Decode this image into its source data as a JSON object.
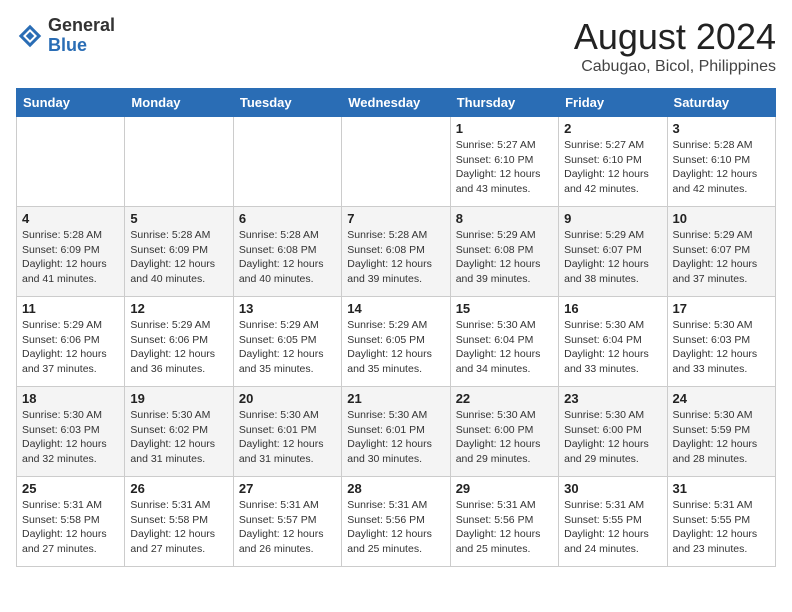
{
  "header": {
    "logo_general": "General",
    "logo_blue": "Blue",
    "title": "August 2024",
    "subtitle": "Cabugao, Bicol, Philippines"
  },
  "weekdays": [
    "Sunday",
    "Monday",
    "Tuesday",
    "Wednesday",
    "Thursday",
    "Friday",
    "Saturday"
  ],
  "weeks": [
    [
      {
        "day": "",
        "info": ""
      },
      {
        "day": "",
        "info": ""
      },
      {
        "day": "",
        "info": ""
      },
      {
        "day": "",
        "info": ""
      },
      {
        "day": "1",
        "info": "Sunrise: 5:27 AM\nSunset: 6:10 PM\nDaylight: 12 hours\nand 43 minutes."
      },
      {
        "day": "2",
        "info": "Sunrise: 5:27 AM\nSunset: 6:10 PM\nDaylight: 12 hours\nand 42 minutes."
      },
      {
        "day": "3",
        "info": "Sunrise: 5:28 AM\nSunset: 6:10 PM\nDaylight: 12 hours\nand 42 minutes."
      }
    ],
    [
      {
        "day": "4",
        "info": "Sunrise: 5:28 AM\nSunset: 6:09 PM\nDaylight: 12 hours\nand 41 minutes."
      },
      {
        "day": "5",
        "info": "Sunrise: 5:28 AM\nSunset: 6:09 PM\nDaylight: 12 hours\nand 40 minutes."
      },
      {
        "day": "6",
        "info": "Sunrise: 5:28 AM\nSunset: 6:08 PM\nDaylight: 12 hours\nand 40 minutes."
      },
      {
        "day": "7",
        "info": "Sunrise: 5:28 AM\nSunset: 6:08 PM\nDaylight: 12 hours\nand 39 minutes."
      },
      {
        "day": "8",
        "info": "Sunrise: 5:29 AM\nSunset: 6:08 PM\nDaylight: 12 hours\nand 39 minutes."
      },
      {
        "day": "9",
        "info": "Sunrise: 5:29 AM\nSunset: 6:07 PM\nDaylight: 12 hours\nand 38 minutes."
      },
      {
        "day": "10",
        "info": "Sunrise: 5:29 AM\nSunset: 6:07 PM\nDaylight: 12 hours\nand 37 minutes."
      }
    ],
    [
      {
        "day": "11",
        "info": "Sunrise: 5:29 AM\nSunset: 6:06 PM\nDaylight: 12 hours\nand 37 minutes."
      },
      {
        "day": "12",
        "info": "Sunrise: 5:29 AM\nSunset: 6:06 PM\nDaylight: 12 hours\nand 36 minutes."
      },
      {
        "day": "13",
        "info": "Sunrise: 5:29 AM\nSunset: 6:05 PM\nDaylight: 12 hours\nand 35 minutes."
      },
      {
        "day": "14",
        "info": "Sunrise: 5:29 AM\nSunset: 6:05 PM\nDaylight: 12 hours\nand 35 minutes."
      },
      {
        "day": "15",
        "info": "Sunrise: 5:30 AM\nSunset: 6:04 PM\nDaylight: 12 hours\nand 34 minutes."
      },
      {
        "day": "16",
        "info": "Sunrise: 5:30 AM\nSunset: 6:04 PM\nDaylight: 12 hours\nand 33 minutes."
      },
      {
        "day": "17",
        "info": "Sunrise: 5:30 AM\nSunset: 6:03 PM\nDaylight: 12 hours\nand 33 minutes."
      }
    ],
    [
      {
        "day": "18",
        "info": "Sunrise: 5:30 AM\nSunset: 6:03 PM\nDaylight: 12 hours\nand 32 minutes."
      },
      {
        "day": "19",
        "info": "Sunrise: 5:30 AM\nSunset: 6:02 PM\nDaylight: 12 hours\nand 31 minutes."
      },
      {
        "day": "20",
        "info": "Sunrise: 5:30 AM\nSunset: 6:01 PM\nDaylight: 12 hours\nand 31 minutes."
      },
      {
        "day": "21",
        "info": "Sunrise: 5:30 AM\nSunset: 6:01 PM\nDaylight: 12 hours\nand 30 minutes."
      },
      {
        "day": "22",
        "info": "Sunrise: 5:30 AM\nSunset: 6:00 PM\nDaylight: 12 hours\nand 29 minutes."
      },
      {
        "day": "23",
        "info": "Sunrise: 5:30 AM\nSunset: 6:00 PM\nDaylight: 12 hours\nand 29 minutes."
      },
      {
        "day": "24",
        "info": "Sunrise: 5:30 AM\nSunset: 5:59 PM\nDaylight: 12 hours\nand 28 minutes."
      }
    ],
    [
      {
        "day": "25",
        "info": "Sunrise: 5:31 AM\nSunset: 5:58 PM\nDaylight: 12 hours\nand 27 minutes."
      },
      {
        "day": "26",
        "info": "Sunrise: 5:31 AM\nSunset: 5:58 PM\nDaylight: 12 hours\nand 27 minutes."
      },
      {
        "day": "27",
        "info": "Sunrise: 5:31 AM\nSunset: 5:57 PM\nDaylight: 12 hours\nand 26 minutes."
      },
      {
        "day": "28",
        "info": "Sunrise: 5:31 AM\nSunset: 5:56 PM\nDaylight: 12 hours\nand 25 minutes."
      },
      {
        "day": "29",
        "info": "Sunrise: 5:31 AM\nSunset: 5:56 PM\nDaylight: 12 hours\nand 25 minutes."
      },
      {
        "day": "30",
        "info": "Sunrise: 5:31 AM\nSunset: 5:55 PM\nDaylight: 12 hours\nand 24 minutes."
      },
      {
        "day": "31",
        "info": "Sunrise: 5:31 AM\nSunset: 5:55 PM\nDaylight: 12 hours\nand 23 minutes."
      }
    ]
  ]
}
